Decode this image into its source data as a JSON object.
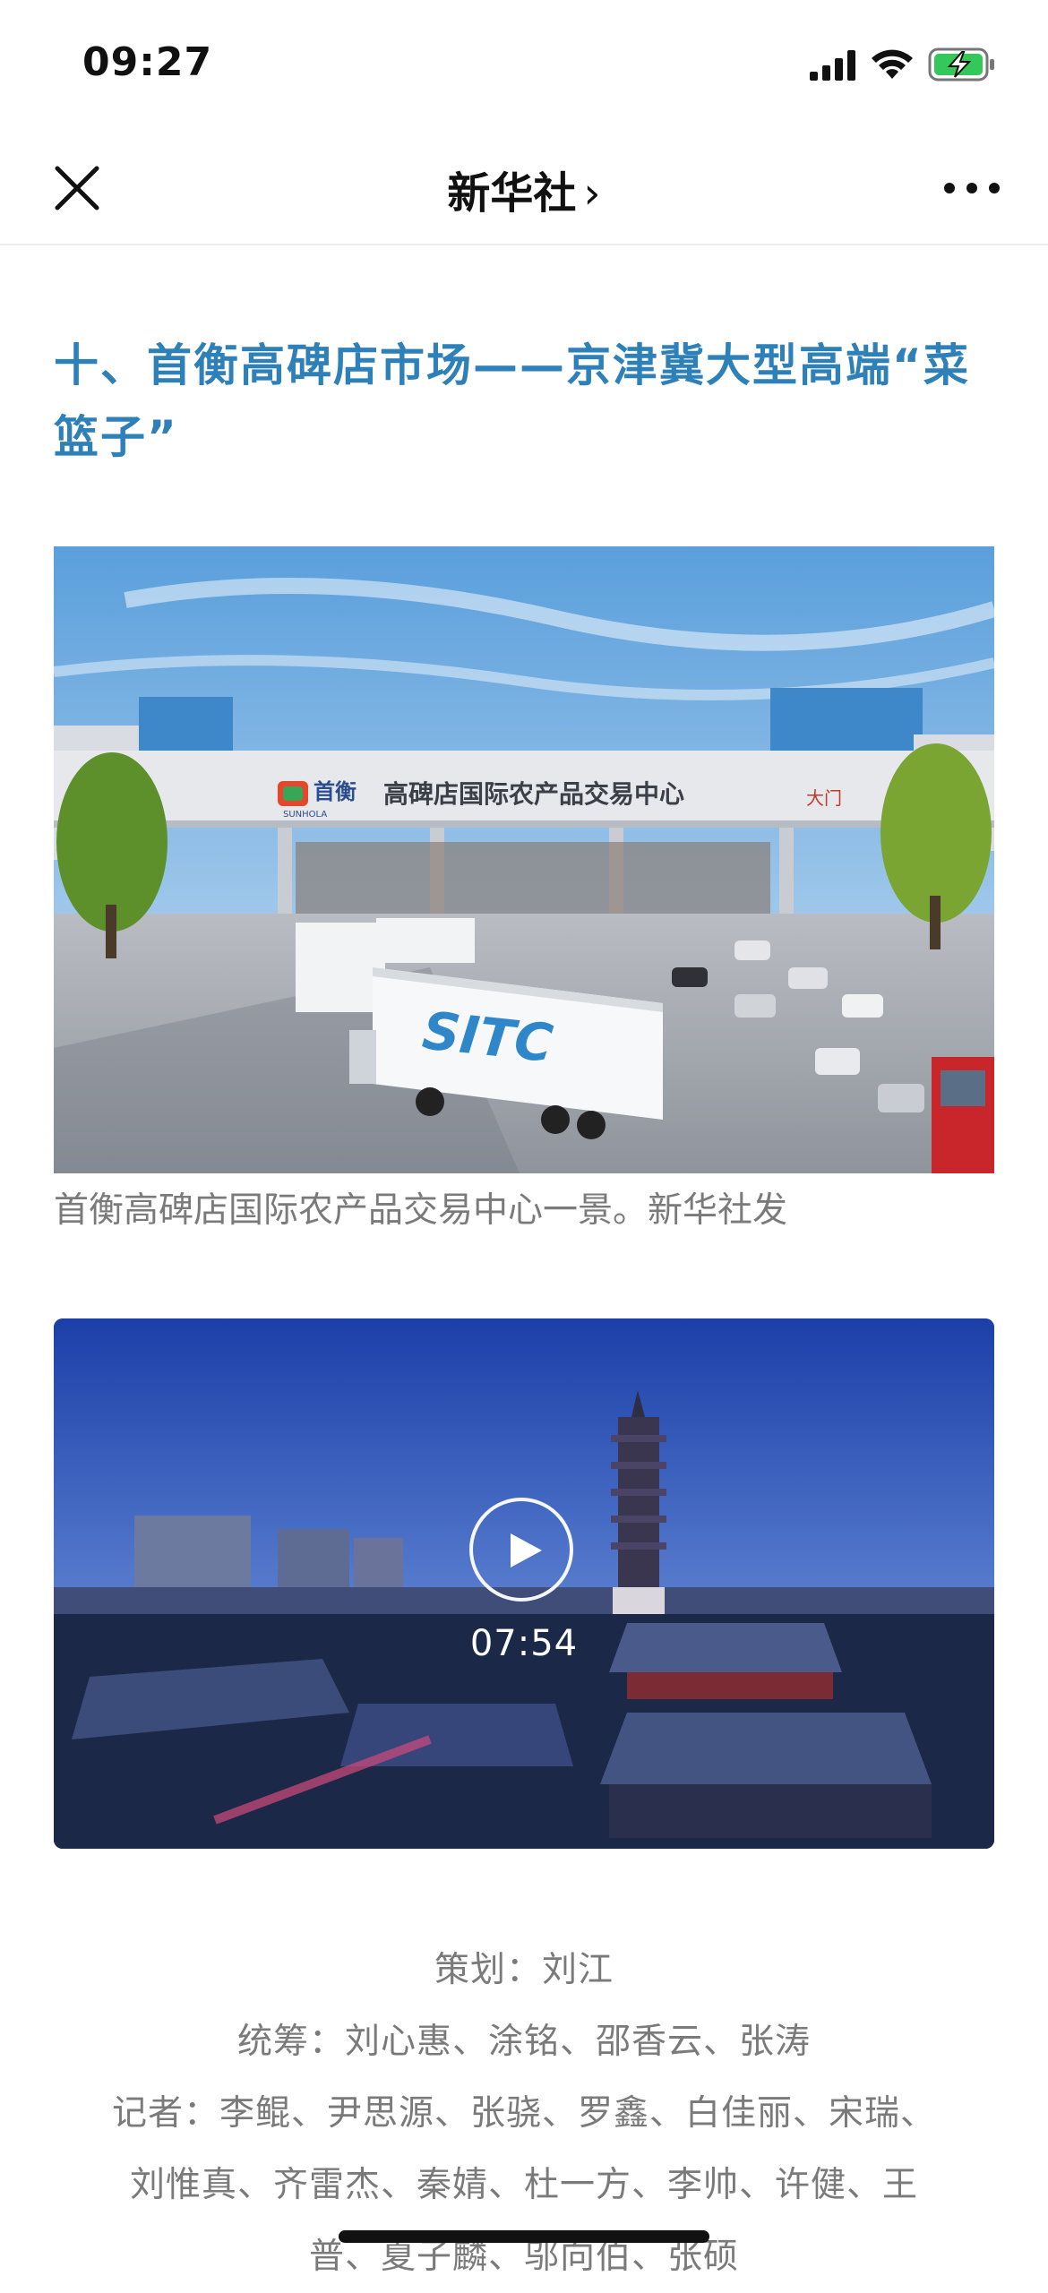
{
  "status_bar": {
    "time": "09:27"
  },
  "nav": {
    "title": "新华社",
    "chevron": "›"
  },
  "article": {
    "headline": "十、首衡高碑店市场——京津冀大型高端“菜篮子”",
    "photo": {
      "sign_text": "高碑店国际农产品交易中心",
      "brand_cn": "首衡",
      "brand_en": "SUNHOLA",
      "gate_text": "大门",
      "truck_text": "SITC",
      "caption": "首衡高碑店国际农产品交易中心一景。新华社发"
    },
    "video": {
      "duration": "07:54"
    },
    "credits": {
      "planning": "策划：刘江",
      "coordination": "统筹：刘心惠、涂铭、邵香云、张涛",
      "reporters_line1": "记者：李鲲、尹思源、张骁、罗鑫、白佳丽、宋瑞、",
      "reporters_line2": "刘惟真、齐雷杰、秦婧、杜一方、李帅、许健、王",
      "reporters_line3": "普、夏子麟、邬向伯、张硕"
    }
  },
  "colors": {
    "headline": "#2e80b8",
    "caption": "#7a7a7a",
    "battery": "#34c759"
  },
  "icons": [
    "signal-icon",
    "wifi-icon",
    "battery-charging-icon",
    "close-icon",
    "chevron-right-icon",
    "more-icon",
    "play-icon"
  ]
}
